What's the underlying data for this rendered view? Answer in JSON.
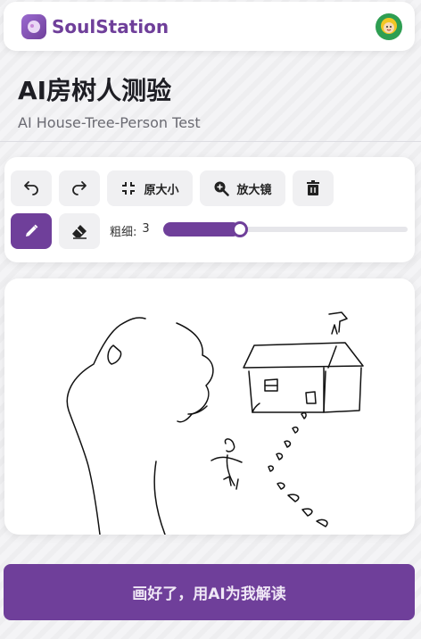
{
  "app": {
    "brand": "SoulStation"
  },
  "page": {
    "title": "AI房树人测验",
    "subtitle": "AI House-Tree-Person Test"
  },
  "toolbar": {
    "undo_icon": "undo-icon",
    "redo_icon": "redo-icon",
    "fit_label": "原大小",
    "zoom_label": "放大镜",
    "delete_icon": "trash-icon",
    "pen_icon": "pencil-icon",
    "eraser_icon": "eraser-icon",
    "thickness_label": "粗细:",
    "thickness_value": "3",
    "thickness_fraction": 0.28
  },
  "actions": {
    "submit_label": "画好了，用AI为我解读"
  },
  "colors": {
    "accent": "#6f3f9a",
    "background": "#f4f4f6"
  }
}
